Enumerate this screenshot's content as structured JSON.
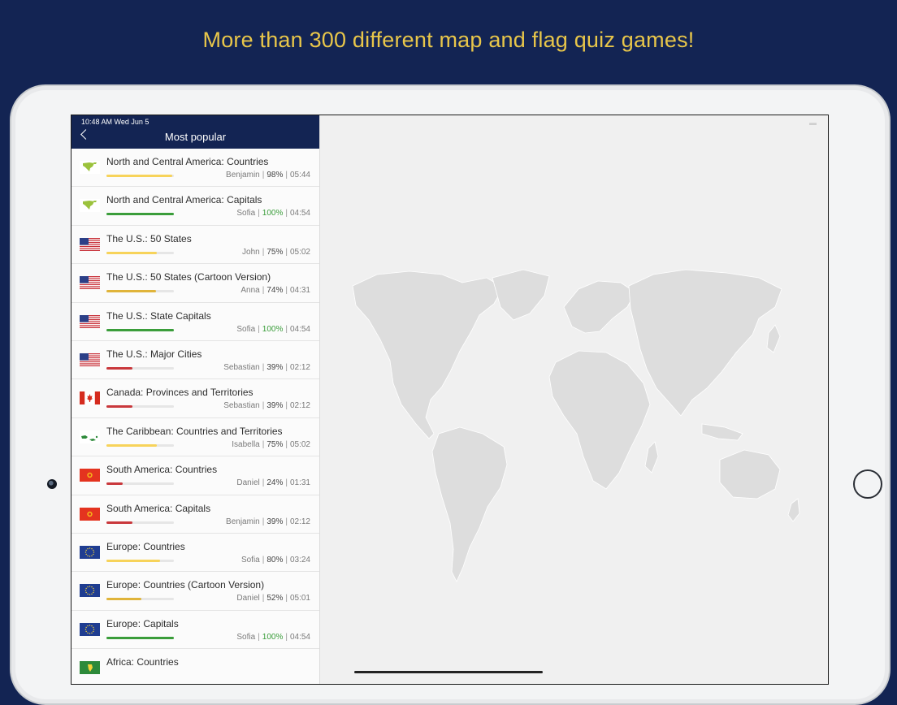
{
  "headline": "More than 300 different map and flag quiz games!",
  "status_bar": {
    "time": "10:48 AM   Wed Jun 5"
  },
  "nav": {
    "title": "Most popular"
  },
  "colors": {
    "background": "#132453",
    "headline": "#e8c64a",
    "bar_yellow": "#f7d35a",
    "bar_gold": "#e0b43a",
    "bar_green": "#3a9d3a",
    "bar_red": "#c9383c"
  },
  "quizzes": [
    {
      "title": "North and Central America: Countries",
      "player": "Benjamin",
      "percent": "98%",
      "progress": 0.98,
      "time": "05:44",
      "flag": "na-map-icon",
      "bar": "#f7d35a"
    },
    {
      "title": "North and Central America: Capitals",
      "player": "Sofia",
      "percent": "100%",
      "progress": 1.0,
      "time": "04:54",
      "flag": "na-map-icon",
      "bar": "#3a9d3a"
    },
    {
      "title": "The U.S.: 50 States",
      "player": "John",
      "percent": "75%",
      "progress": 0.75,
      "time": "05:02",
      "flag": "us-flag-icon",
      "bar": "#f7d35a"
    },
    {
      "title": "The U.S.: 50 States (Cartoon Version)",
      "player": "Anna",
      "percent": "74%",
      "progress": 0.74,
      "time": "04:31",
      "flag": "us-flag-icon",
      "bar": "#e0b43a"
    },
    {
      "title": "The U.S.: State Capitals",
      "player": "Sofia",
      "percent": "100%",
      "progress": 1.0,
      "time": "04:54",
      "flag": "us-flag-icon",
      "bar": "#3a9d3a"
    },
    {
      "title": "The U.S.: Major Cities",
      "player": "Sebastian",
      "percent": "39%",
      "progress": 0.39,
      "time": "02:12",
      "flag": "us-flag-icon",
      "bar": "#c9383c"
    },
    {
      "title": "Canada: Provinces and Territories",
      "player": "Sebastian",
      "percent": "39%",
      "progress": 0.39,
      "time": "02:12",
      "flag": "ca-flag-icon",
      "bar": "#c9383c"
    },
    {
      "title": "The Caribbean: Countries and Territories",
      "player": "Isabella",
      "percent": "75%",
      "progress": 0.75,
      "time": "05:02",
      "flag": "caribbean-map-icon",
      "bar": "#f7d35a"
    },
    {
      "title": "South America: Countries",
      "player": "Daniel",
      "percent": "24%",
      "progress": 0.24,
      "time": "01:31",
      "flag": "sa-flag-icon",
      "bar": "#c9383c"
    },
    {
      "title": "South America: Capitals",
      "player": "Benjamin",
      "percent": "39%",
      "progress": 0.39,
      "time": "02:12",
      "flag": "sa-flag-icon",
      "bar": "#c9383c"
    },
    {
      "title": "Europe: Countries",
      "player": "Sofia",
      "percent": "80%",
      "progress": 0.8,
      "time": "03:24",
      "flag": "eu-flag-icon",
      "bar": "#f7d35a"
    },
    {
      "title": "Europe: Countries (Cartoon Version)",
      "player": "Daniel",
      "percent": "52%",
      "progress": 0.52,
      "time": "05:01",
      "flag": "eu-flag-icon",
      "bar": "#e0b43a"
    },
    {
      "title": "Europe: Capitals",
      "player": "Sofia",
      "percent": "100%",
      "progress": 1.0,
      "time": "04:54",
      "flag": "eu-flag-icon",
      "bar": "#3a9d3a"
    },
    {
      "title": "Africa: Countries",
      "player": "",
      "percent": "",
      "progress": 0,
      "time": "",
      "flag": "africa-flag-icon",
      "bar": "#e6e6e6"
    }
  ]
}
